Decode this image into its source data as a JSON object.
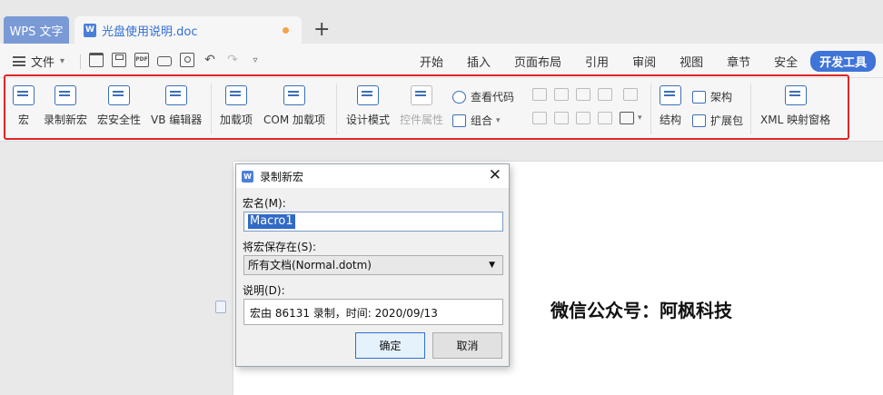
{
  "tabs": {
    "app_label": "WPS 文字",
    "doc_title": "光盘使用说明.doc",
    "doc_icon": "W",
    "add_label": "+"
  },
  "menu": {
    "file_label": "文件",
    "items": [
      "开始",
      "插入",
      "页面布局",
      "引用",
      "审阅",
      "视图",
      "章节",
      "安全",
      "开发工具"
    ],
    "active": "开发工具"
  },
  "ribbon": {
    "macro": "宏",
    "record_macro": "录制新宏",
    "macro_security": "宏安全性",
    "vb_editor": "VB 编辑器",
    "addins": "加载项",
    "com_addins": "COM 加载项",
    "design_mode": "设计模式",
    "control_props": "控件属性",
    "view_code": "查看代码",
    "group": "组合",
    "structure": "结构",
    "schema": "架构",
    "expansion_pack": "扩展包",
    "xml_pane": "XML 映射窗格"
  },
  "document": {
    "text": "微信公众号：阿枫科技"
  },
  "dialog": {
    "icon": "W",
    "title": "录制新宏",
    "name_label": "宏名(M):",
    "name_value": "Macro1",
    "store_label": "将宏保存在(S):",
    "store_value": "所有文档(Normal.dotm)",
    "desc_label": "说明(D):",
    "desc_value": "宏由 86131 录制，时间: 2020/09/13",
    "ok_label": "确定",
    "cancel_label": "取消",
    "close_glyph": "✕"
  },
  "colors": {
    "accent": "#3f74d9",
    "highlight": "#e02626"
  }
}
